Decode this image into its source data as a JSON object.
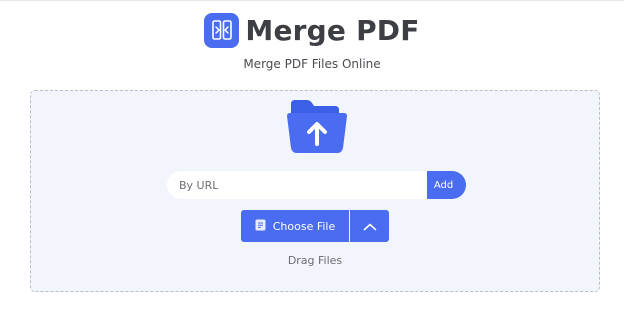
{
  "header": {
    "title": "Merge PDF",
    "subtitle": "Merge PDF Files Online",
    "logo_icon": "merge-document-icon"
  },
  "upload": {
    "folder_icon": "folder-upload-icon",
    "url_placeholder": "By URL",
    "url_value": "",
    "add_label": "Add",
    "choose_label": "Choose File",
    "choose_icon": "file-icon",
    "menu_icon": "chevron-up-icon",
    "drag_label": "Drag Files"
  },
  "colors": {
    "accent": "#4a6cf0",
    "dropzone_bg": "#f3f5fd",
    "title_text": "#3d3f45"
  }
}
